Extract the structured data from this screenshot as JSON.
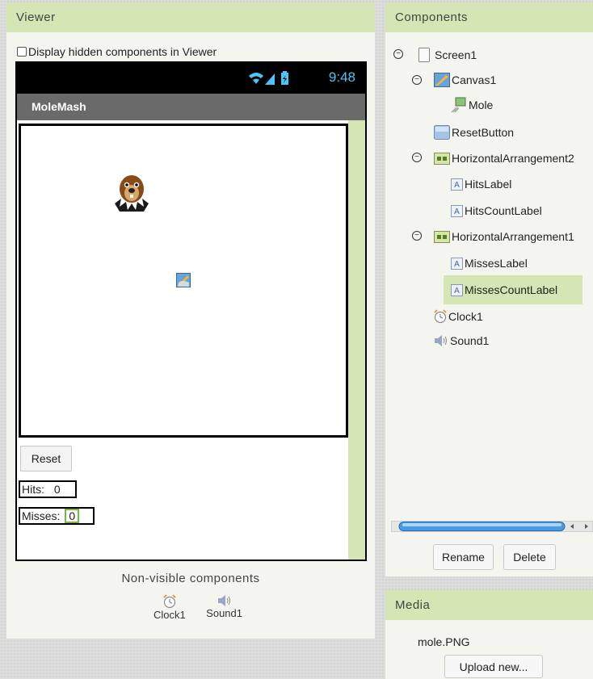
{
  "viewer": {
    "title": "Viewer",
    "display_hidden_label": "Display hidden components in Viewer",
    "status_time": "9:48",
    "app_title": "MoleMash",
    "reset_label": "Reset",
    "hits_label": "Hits:",
    "hits_count": "0",
    "misses_label": "Misses:",
    "misses_count": "0",
    "nonvisible_title": "Non-visible components",
    "nonvisible": [
      {
        "label": "Clock1",
        "icon": "clock-icon"
      },
      {
        "label": "Sound1",
        "icon": "speaker-icon"
      }
    ]
  },
  "components": {
    "title": "Components",
    "tree": [
      {
        "label": "Screen1",
        "icon": "screen-icon"
      },
      {
        "label": "Canvas1",
        "icon": "canvas-icon"
      },
      {
        "label": "Mole",
        "icon": "image-sprite-icon"
      },
      {
        "label": "ResetButton",
        "icon": "button-icon"
      },
      {
        "label": "HorizontalArrangement2",
        "icon": "horizontal-arrangement-icon"
      },
      {
        "label": "HitsLabel",
        "icon": "label-icon"
      },
      {
        "label": "HitsCountLabel",
        "icon": "label-icon"
      },
      {
        "label": "HorizontalArrangement1",
        "icon": "horizontal-arrangement-icon"
      },
      {
        "label": "MissesLabel",
        "icon": "label-icon"
      },
      {
        "label": "MissesCountLabel",
        "icon": "label-icon",
        "selected": true
      },
      {
        "label": "Clock1",
        "icon": "clock-icon"
      },
      {
        "label": "Sound1",
        "icon": "speaker-icon"
      }
    ],
    "rename_label": "Rename",
    "delete_label": "Delete"
  },
  "media": {
    "title": "Media",
    "file": "mole.PNG",
    "upload_label": "Upload new..."
  },
  "colors": {
    "header_green": "#d5e6b4",
    "status_blue": "#4fc3f7",
    "title_bar_gray": "#6a6a6a"
  }
}
